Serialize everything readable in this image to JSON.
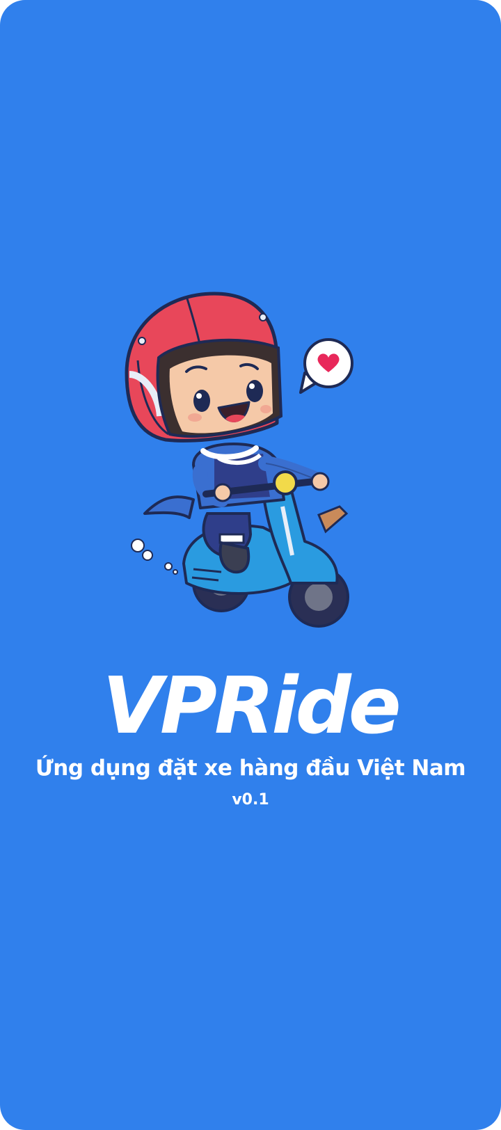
{
  "app": {
    "name": "VPRide",
    "tagline": "Ứng dụng đặt xe hàng đầu Việt Nam",
    "version": "v0.1"
  },
  "illustration": {
    "icon": "scooter-rider-illustration",
    "bubble_icon": "heart-icon"
  },
  "colors": {
    "background": "#3080EC",
    "text": "#FFFFFF",
    "helmet": "#E8475A",
    "scooter": "#2A9BE0",
    "heart": "#E8285A"
  }
}
